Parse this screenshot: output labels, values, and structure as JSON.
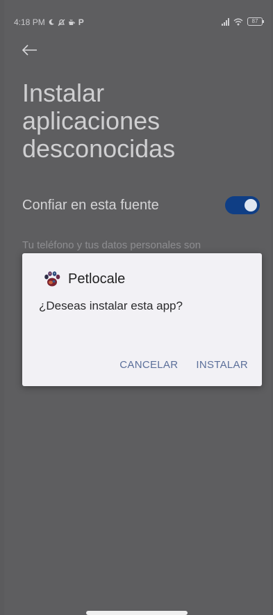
{
  "status_bar": {
    "time": "4:18 PM",
    "icons": [
      "moon-icon",
      "bell-off-icon",
      "tea-icon",
      "p-icon"
    ],
    "p_glyph": "P",
    "battery": "87"
  },
  "page": {
    "back_icon": "arrow-left-icon",
    "title": "Instalar aplicaciones desconocidas",
    "trust_label": "Confiar en esta fuente",
    "trust_enabled": true,
    "warning_text": "Tu teléfono y tus datos personales son"
  },
  "dialog": {
    "app_name": "Petlocale",
    "message": "¿Deseas instalar esta app?",
    "cancel_label": "CANCELAR",
    "install_label": "INSTALAR"
  },
  "colors": {
    "toggle_on": "#0f3e85",
    "dialog_button": "#5b6f9a",
    "scrim": "#5e5e60"
  }
}
